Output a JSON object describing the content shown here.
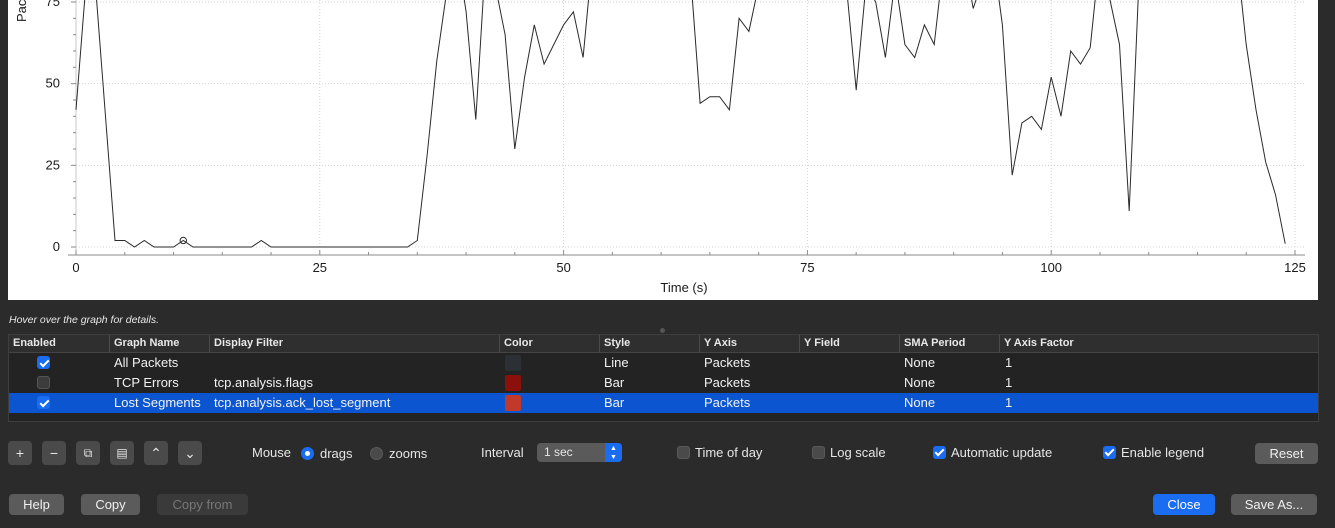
{
  "chart_data": {
    "type": "line",
    "xlabel": "Time (s)",
    "ylabel": "Pac",
    "xlim": [
      0,
      125
    ],
    "ylim_visible": [
      0,
      75
    ],
    "x_ticks": [
      0,
      25,
      50,
      75,
      100,
      125
    ],
    "y_ticks": [
      0,
      25,
      50,
      75
    ],
    "grid": true,
    "series": [
      {
        "name": "All Packets",
        "color": "#2a2a2a",
        "points": [
          [
            0,
            42
          ],
          [
            1,
            80
          ],
          [
            1.5,
            90
          ],
          [
            2,
            80
          ],
          [
            4,
            2
          ],
          [
            5,
            2
          ],
          [
            6,
            0
          ],
          [
            7,
            2
          ],
          [
            8,
            0
          ],
          [
            9,
            0
          ],
          [
            10,
            0
          ],
          [
            11,
            2
          ],
          [
            12,
            0
          ],
          [
            13,
            0
          ],
          [
            14,
            0
          ],
          [
            15,
            0
          ],
          [
            16,
            0
          ],
          [
            17,
            0
          ],
          [
            18,
            0
          ],
          [
            19,
            2
          ],
          [
            20,
            0
          ],
          [
            21,
            0
          ],
          [
            22,
            0
          ],
          [
            23,
            0
          ],
          [
            24,
            0
          ],
          [
            25,
            0
          ],
          [
            26,
            0
          ],
          [
            27,
            0
          ],
          [
            28,
            0
          ],
          [
            29,
            0
          ],
          [
            30,
            0
          ],
          [
            31,
            0
          ],
          [
            32,
            0
          ],
          [
            33,
            0
          ],
          [
            34,
            0
          ],
          [
            35,
            2
          ],
          [
            36,
            28
          ],
          [
            37,
            57
          ],
          [
            38,
            78
          ],
          [
            39,
            92
          ],
          [
            40,
            72
          ],
          [
            41,
            39
          ],
          [
            42,
            88
          ],
          [
            43,
            80
          ],
          [
            44,
            65
          ],
          [
            45,
            30
          ],
          [
            46,
            52
          ],
          [
            47,
            68
          ],
          [
            48,
            56
          ],
          [
            49,
            62
          ],
          [
            50,
            68
          ],
          [
            51,
            72
          ],
          [
            52,
            58
          ],
          [
            53,
            90
          ],
          [
            60,
            90
          ],
          [
            63,
            84
          ],
          [
            64,
            44
          ],
          [
            65,
            46
          ],
          [
            66,
            46
          ],
          [
            67,
            42
          ],
          [
            68,
            70
          ],
          [
            69,
            66
          ],
          [
            70,
            80
          ],
          [
            71,
            90
          ],
          [
            78,
            90
          ],
          [
            79,
            80
          ],
          [
            80,
            48
          ],
          [
            81,
            80
          ],
          [
            82,
            75
          ],
          [
            83,
            58
          ],
          [
            84,
            82
          ],
          [
            85,
            62
          ],
          [
            86,
            58
          ],
          [
            87,
            68
          ],
          [
            88,
            62
          ],
          [
            89,
            88
          ],
          [
            91,
            90
          ],
          [
            92,
            73
          ],
          [
            93,
            82
          ],
          [
            94,
            90
          ],
          [
            95,
            68
          ],
          [
            96,
            22
          ],
          [
            97,
            38
          ],
          [
            98,
            40
          ],
          [
            99,
            36
          ],
          [
            100,
            52
          ],
          [
            101,
            40
          ],
          [
            102,
            60
          ],
          [
            103,
            56
          ],
          [
            104,
            61
          ],
          [
            105,
            90
          ],
          [
            107,
            62
          ],
          [
            108,
            11
          ],
          [
            109,
            82
          ],
          [
            110,
            90
          ],
          [
            119,
            90
          ],
          [
            120,
            62
          ],
          [
            121,
            42
          ],
          [
            122,
            26
          ],
          [
            123,
            16
          ],
          [
            124,
            1
          ]
        ]
      }
    ],
    "marker_point": [
      11,
      2
    ]
  },
  "hover_hint": "Hover over the graph for details.",
  "table": {
    "headers": [
      "Enabled",
      "Graph Name",
      "Display Filter",
      "Color",
      "Style",
      "Y Axis",
      "Y Field",
      "SMA Period",
      "Y Axis Factor"
    ],
    "rows": [
      {
        "enabled": true,
        "name": "All Packets",
        "filter": "",
        "color": "#2c2f33",
        "style": "Line",
        "y_axis": "Packets",
        "y_field": "",
        "sma": "None",
        "factor": "1",
        "selected": false
      },
      {
        "enabled": false,
        "name": "TCP Errors",
        "filter": "tcp.analysis.flags",
        "color": "#8b0f0a",
        "style": "Bar",
        "y_axis": "Packets",
        "y_field": "",
        "sma": "None",
        "factor": "1",
        "selected": false
      },
      {
        "enabled": true,
        "name": "Lost Segments",
        "filter": "tcp.analysis.ack_lost_segment",
        "color": "#c0392b",
        "style": "Bar",
        "y_axis": "Packets",
        "y_field": "",
        "sma": "None",
        "factor": "1",
        "selected": true
      }
    ]
  },
  "toolbar": {
    "add": "+",
    "remove": "−",
    "copy_graph": "⧉",
    "clear": "▤",
    "up": "⌃",
    "down": "⌄",
    "mouse_label": "Mouse",
    "drags_label": "drags",
    "zooms_label": "zooms",
    "mouse_mode": "drags",
    "interval_label": "Interval",
    "interval_value": "1 sec",
    "time_of_day": "Time of day",
    "time_of_day_checked": false,
    "log_scale": "Log scale",
    "log_scale_checked": false,
    "auto_update": "Automatic update",
    "auto_update_checked": true,
    "enable_legend": "Enable legend",
    "enable_legend_checked": true,
    "reset": "Reset"
  },
  "buttons": {
    "help": "Help",
    "copy": "Copy",
    "copy_from": "Copy from",
    "close": "Close",
    "save_as": "Save As..."
  }
}
